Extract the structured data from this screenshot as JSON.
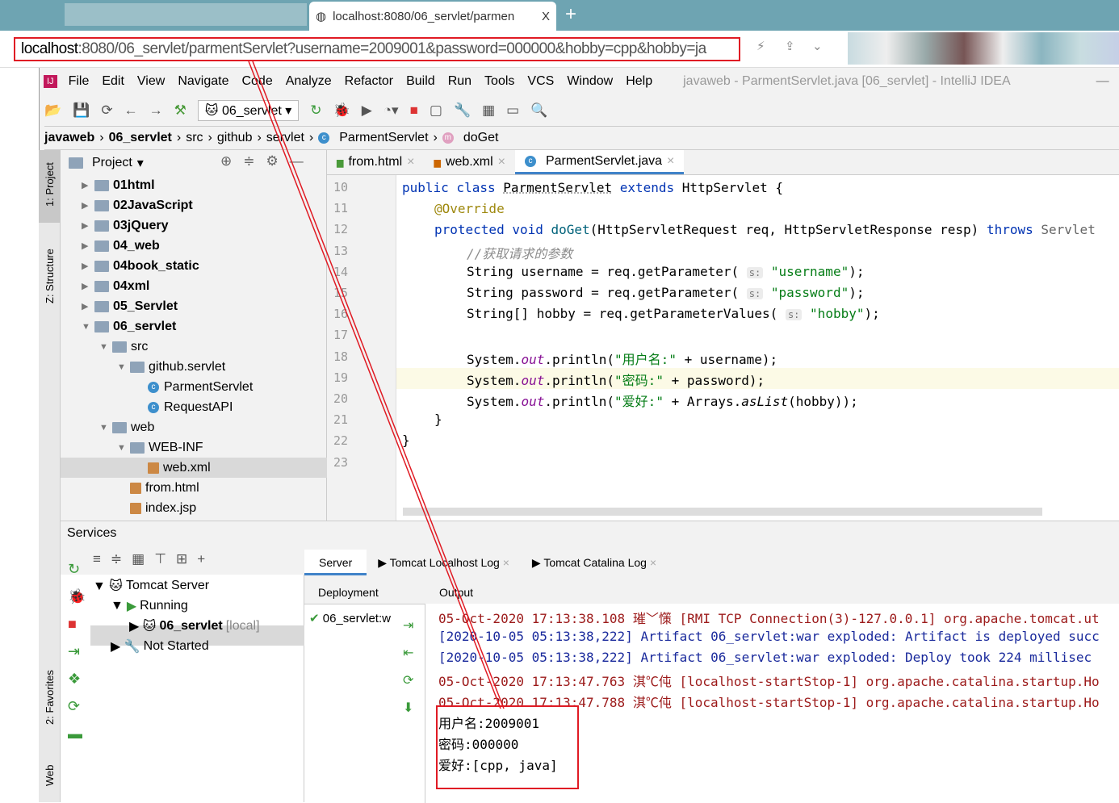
{
  "browser": {
    "tab_title": "localhost:8080/06_servlet/parmen",
    "tab_close": "X",
    "new_tab": "+",
    "url_host": "localhost",
    "url_rest": ":8080/06_servlet/parmentServlet?username=2009001&password=000000&hobby=cpp&hobby=ja"
  },
  "menu": [
    "File",
    "Edit",
    "View",
    "Navigate",
    "Code",
    "Analyze",
    "Refactor",
    "Build",
    "Run",
    "Tools",
    "VCS",
    "Window",
    "Help"
  ],
  "window_title": "javaweb - ParmentServlet.java [06_servlet] - IntelliJ IDEA",
  "run_config": "06_servlet",
  "breadcrumb": [
    "javaweb",
    "06_servlet",
    "src",
    "github",
    "servlet",
    "ParmentServlet",
    "doGet"
  ],
  "side_tabs": {
    "project": "1: Project",
    "structure": "Z: Structure",
    "favorites": "2: Favorites",
    "web": "Web"
  },
  "project": {
    "title": "Project",
    "items": [
      {
        "label": "01html",
        "level": 0,
        "type": "folder",
        "state": "collapsed",
        "bold": true
      },
      {
        "label": "02JavaScript",
        "level": 0,
        "type": "folder",
        "state": "collapsed",
        "bold": true
      },
      {
        "label": "03jQuery",
        "level": 0,
        "type": "folder",
        "state": "collapsed",
        "bold": true
      },
      {
        "label": "04_web",
        "level": 0,
        "type": "folder",
        "state": "collapsed",
        "bold": true
      },
      {
        "label": "04book_static",
        "level": 0,
        "type": "folder",
        "state": "collapsed",
        "bold": true
      },
      {
        "label": "04xml",
        "level": 0,
        "type": "folder",
        "state": "collapsed",
        "bold": true
      },
      {
        "label": "05_Servlet",
        "level": 0,
        "type": "folder",
        "state": "collapsed",
        "bold": true
      },
      {
        "label": "06_servlet",
        "level": 0,
        "type": "folder",
        "state": "expanded",
        "bold": true
      },
      {
        "label": "src",
        "level": 1,
        "type": "folder",
        "state": "expanded"
      },
      {
        "label": "github.servlet",
        "level": 2,
        "type": "folder",
        "state": "expanded"
      },
      {
        "label": "ParmentServlet",
        "level": 3,
        "type": "class"
      },
      {
        "label": "RequestAPI",
        "level": 3,
        "type": "class"
      },
      {
        "label": "web",
        "level": 1,
        "type": "folder",
        "state": "expanded"
      },
      {
        "label": "WEB-INF",
        "level": 2,
        "type": "folder",
        "state": "expanded"
      },
      {
        "label": "web.xml",
        "level": 3,
        "type": "file",
        "selected": true
      },
      {
        "label": "from.html",
        "level": 2,
        "type": "file"
      },
      {
        "label": "index.jsp",
        "level": 2,
        "type": "file"
      }
    ]
  },
  "editor": {
    "tabs": [
      {
        "label": "from.html"
      },
      {
        "label": "web.xml"
      },
      {
        "label": "ParmentServlet.java",
        "active": true
      }
    ],
    "line_numbers": [
      "10",
      "11",
      "12",
      "13",
      "14",
      "15",
      "16",
      "17",
      "18",
      "19",
      "20",
      "21",
      "22",
      "23"
    ]
  },
  "code": {
    "l10a": "public class ",
    "l10b": "ParmentServlet",
    "l10c": " extends ",
    "l10d": "HttpServlet {",
    "l11": "@Override",
    "l12a": "protected void ",
    "l12b": "doGet",
    "l12c": "(HttpServletRequest req, HttpServletResponse resp) ",
    "l12d": "throws ",
    "l12e": "Servlet",
    "l13": "//获取请求的参数",
    "l14a": "String username = req.getParameter( ",
    "hint": "s:",
    "l14b": "\"username\"",
    "l14c": ");",
    "l15a": "String password = req.getParameter( ",
    "l15b": "\"password\"",
    "l15c": ");",
    "l16a": "String[] hobby = req.getParameterValues( ",
    "l16b": "\"hobby\"",
    "l16c": ");",
    "sys": "System.",
    "out": "out",
    "println": ".println(",
    "l18a": "\"用户名:\"",
    "l18b": " + username);",
    "l19a": "\"密码:\"",
    "l19b": " + password);",
    "l20a": "\"爱好:\"",
    "l20b": " + Arrays.",
    "aslist": "asList",
    "l20c": "(hobby));",
    "l21": "}",
    "l22": "}"
  },
  "services": {
    "title": "Services",
    "tree": [
      {
        "label": "Tomcat Server"
      },
      {
        "label": "Running"
      },
      {
        "label": "06_servlet",
        "suffix": "[local]"
      },
      {
        "label": "Not Started"
      }
    ],
    "tabs": [
      "Server",
      "Tomcat Localhost Log",
      "Tomcat Catalina Log"
    ],
    "deployment_header": "Deployment",
    "output_header": "Output",
    "deployment_item": "06_servlet:w",
    "output": [
      {
        "text": "05-Oct-2020 17:13:38.108 璀﹀憡 [RMI TCP Connection(3)-127.0.0.1] org.apache.tomcat.ut",
        "color": "red"
      },
      {
        "text": "[2020-10-05 05:13:38,222] Artifact 06_servlet:war exploded: Artifact is deployed succ",
        "color": "blue"
      },
      {
        "text": "[2020-10-05 05:13:38,222] Artifact 06_servlet:war exploded: Deploy took 224 millisec",
        "color": "blue"
      },
      {
        "text": "05-Oct-2020 17:13:47.763 淇℃伅 [localhost-startStop-1] org.apache.catalina.startup.Ho",
        "color": "red"
      },
      {
        "text": "05-Oct-2020 17:13:47.788 淇℃伅 [localhost-startStop-1] org.apache.catalina.startup.Ho",
        "color": "red"
      },
      {
        "text": "用户名:2009001",
        "color": "black"
      },
      {
        "text": "密码:000000",
        "color": "black"
      },
      {
        "text": "爱好:[cpp, java]",
        "color": "black"
      }
    ]
  },
  "colors": {
    "annotation_red": "#e01b24",
    "browser_chrome": "#6ea4b2"
  }
}
